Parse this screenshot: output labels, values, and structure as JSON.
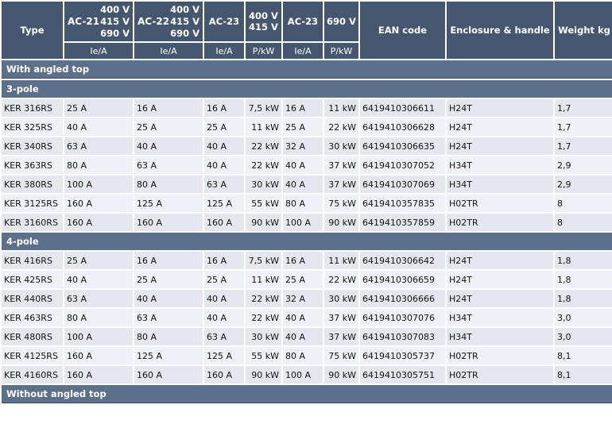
{
  "header": {
    "type": "Type",
    "ac21": {
      "class": "AC-21",
      "volts": [
        "400 V",
        "415 V",
        "690 V"
      ],
      "unit": "Ie/A"
    },
    "ac22": {
      "class": "AC-22",
      "volts": [
        "400 V",
        "415 V",
        "690 V"
      ],
      "unit": "Ie/A"
    },
    "ac23a": {
      "class": "AC-23",
      "unit": "Ie/A"
    },
    "p400": {
      "volts": [
        "400 V",
        "415 V"
      ],
      "unit": "P/kW"
    },
    "ac23b": {
      "class": "AC-23",
      "unit": "Ie/A"
    },
    "p690": {
      "volts": "690 V",
      "unit": "P/kW"
    },
    "ean": "EAN code",
    "enclosure": "Enclosure & handle",
    "weight": "Weight kg"
  },
  "sections": {
    "with_angled_top": "With angled top",
    "three_pole": "3-pole",
    "four_pole": "4-pole",
    "without_angled_top": "Without angled top"
  },
  "rows3": [
    [
      "KER 316RS",
      "25 A",
      "16 A",
      "16 A",
      "7,5 kW",
      "16 A",
      "11 kW",
      "6419410306611",
      "H24T",
      "1,7"
    ],
    [
      "KER 325RS",
      "40 A",
      "25 A",
      "25 A",
      "11 kW",
      "25 A",
      "22 kW",
      "6419410306628",
      "H24T",
      "1,7"
    ],
    [
      "KER 340RS",
      "63 A",
      "40 A",
      "40 A",
      "22 kW",
      "32 A",
      "30 kW",
      "6419410306635",
      "H24T",
      "1,7"
    ],
    [
      "KER 363RS",
      "80 A",
      "63 A",
      "40 A",
      "22 kW",
      "40 A",
      "37 kW",
      "6419410307052",
      "H34T",
      "2,9"
    ],
    [
      "KER 380RS",
      "100 A",
      "80 A",
      "63 A",
      "30 kW",
      "40 A",
      "37 kW",
      "6419410307069",
      "H34T",
      "2,9"
    ],
    [
      "KER 3125RS",
      "160 A",
      "125 A",
      "125 A",
      "55 kW",
      "80 A",
      "75 kW",
      "6419410357835",
      "H02TR",
      "8"
    ],
    [
      "KER 3160RS",
      "160 A",
      "160 A",
      "160 A",
      "90 kW",
      "100 A",
      "90 kW",
      "6419410357859",
      "H02TR",
      "8"
    ]
  ],
  "rows4": [
    [
      "KER 416RS",
      "25 A",
      "16 A",
      "16 A",
      "7,5 kW",
      "16 A",
      "11 kW",
      "6419410306642",
      "H24T",
      "1,8"
    ],
    [
      "KER 425RS",
      "40 A",
      "25 A",
      "25 A",
      "11 kW",
      "25 A",
      "22 kW",
      "6419410306659",
      "H24T",
      "1,8"
    ],
    [
      "KER 440RS",
      "63 A",
      "40 A",
      "40 A",
      "22 kW",
      "32 A",
      "30 kW",
      "6419410306666",
      "H24T",
      "1,8"
    ],
    [
      "KER 463RS",
      "80 A",
      "63 A",
      "40 A",
      "22 kW",
      "40 A",
      "37 kW",
      "6419410307076",
      "H34T",
      "3,0"
    ],
    [
      "KER 480RS",
      "100 A",
      "80 A",
      "63 A",
      "30 kW",
      "40 A",
      "37 kW",
      "6419410307083",
      "H34T",
      "3,0"
    ],
    [
      "KER 4125RS",
      "160 A",
      "125 A",
      "125 A",
      "55 kW",
      "80 A",
      "75 kW",
      "6419410305737",
      "H02TR",
      "8,1"
    ],
    [
      "KER 4160RS",
      "160 A",
      "160 A",
      "160 A",
      "90 kW",
      "100 A",
      "90 kW",
      "6419410305751",
      "H02TR",
      "8,1"
    ]
  ]
}
